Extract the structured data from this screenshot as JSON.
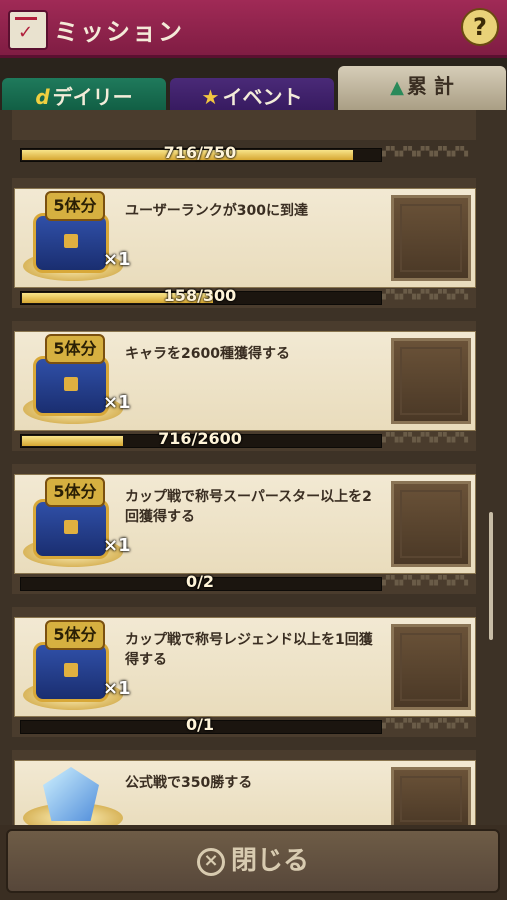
{
  "header": {
    "title": "ミッション",
    "help": "?"
  },
  "tabs": [
    {
      "label": "デイリー"
    },
    {
      "label": "イベント"
    },
    {
      "label": "累 計"
    }
  ],
  "list": {
    "top_progress": "716/750",
    "top_fill": 0.92,
    "missions": [
      {
        "reward_badge": "5体分",
        "qty": "×1",
        "desc": "ユーザーランクが300に到達",
        "progress": "158/300",
        "fill": 0.53
      },
      {
        "reward_badge": "5体分",
        "qty": "×1",
        "desc": "キャラを2600種獲得する",
        "progress": "716/2600",
        "fill": 0.28
      },
      {
        "reward_badge": "5体分",
        "qty": "×1",
        "desc": "カップ戦で称号スーパースター以上を2回獲得する",
        "progress": "0/2",
        "fill": 0
      },
      {
        "reward_badge": "5体分",
        "qty": "×1",
        "desc": "カップ戦で称号レジェンド以上を1回獲得する",
        "progress": "0/1",
        "fill": 0
      },
      {
        "desc": "公式戦で350勝する"
      }
    ]
  },
  "footer": {
    "close_label": "閉じる"
  }
}
